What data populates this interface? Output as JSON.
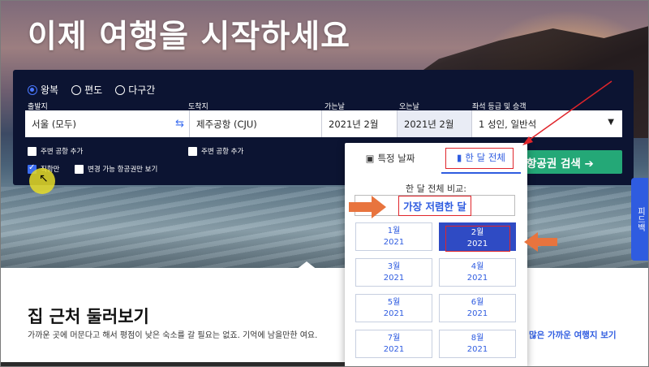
{
  "hero": {
    "title": "이제 여행을 시작하세요"
  },
  "trip_type": {
    "options": [
      "왕복",
      "편도",
      "다구간"
    ],
    "selected": "왕복"
  },
  "fields": {
    "origin": {
      "label": "출발지",
      "value": "서울 (모두)"
    },
    "destination": {
      "label": "도착지",
      "value": "제주공항 (CJU)"
    },
    "depart": {
      "label": "가는날",
      "value": "2021년 2월"
    },
    "return": {
      "label": "오는날",
      "value": "2021년 2월"
    },
    "cabin": {
      "label": "좌석 등급 및 승객",
      "value": "1 성인, 일반석"
    }
  },
  "checkboxes": {
    "nearby_origin": {
      "label": "주변 공항 추가",
      "checked": false
    },
    "nearby_dest": {
      "label": "주변 공항 추가",
      "checked": false
    },
    "direct": {
      "label": "직항만",
      "checked": true
    },
    "flexible": {
      "label": "변경 가능 항공권만 보기",
      "checked": false
    }
  },
  "search_button": {
    "label": "항공권 검색 ➔"
  },
  "side_tab": {
    "label": "피드백"
  },
  "popup": {
    "tabs": [
      {
        "label": "특정 날짜",
        "icon": "calendar-icon",
        "active": false
      },
      {
        "label": "한 달 전체",
        "icon": "bar-chart-icon",
        "active": true
      }
    ],
    "compare_label": "한 달 전체 비교:",
    "cheapest_label": "가장 저렴한 달",
    "months": [
      {
        "month": "1월",
        "year": "2021",
        "selected": false
      },
      {
        "month": "2월",
        "year": "2021",
        "selected": true
      },
      {
        "month": "3월",
        "year": "2021",
        "selected": false
      },
      {
        "month": "4월",
        "year": "2021",
        "selected": false
      },
      {
        "month": "5월",
        "year": "2021",
        "selected": false
      },
      {
        "month": "6월",
        "year": "2021",
        "selected": false
      },
      {
        "month": "7월",
        "year": "2021",
        "selected": false
      },
      {
        "month": "8월",
        "year": "2021",
        "selected": false
      }
    ]
  },
  "nearby": {
    "title": "집 근처 둘러보기",
    "text": "가까운 곳에 머문다고 해서 평점이 낮은 숙소를 갈 필요는 없죠. 기억에 남을만한 여요.",
    "link": "많은 가까운 여행지 보기"
  },
  "colors": {
    "panel": "#0c1432",
    "accent": "#2f5ce0",
    "search": "#24a877",
    "highlight": "#e0252b",
    "annotation_arrow": "#e8743e"
  }
}
